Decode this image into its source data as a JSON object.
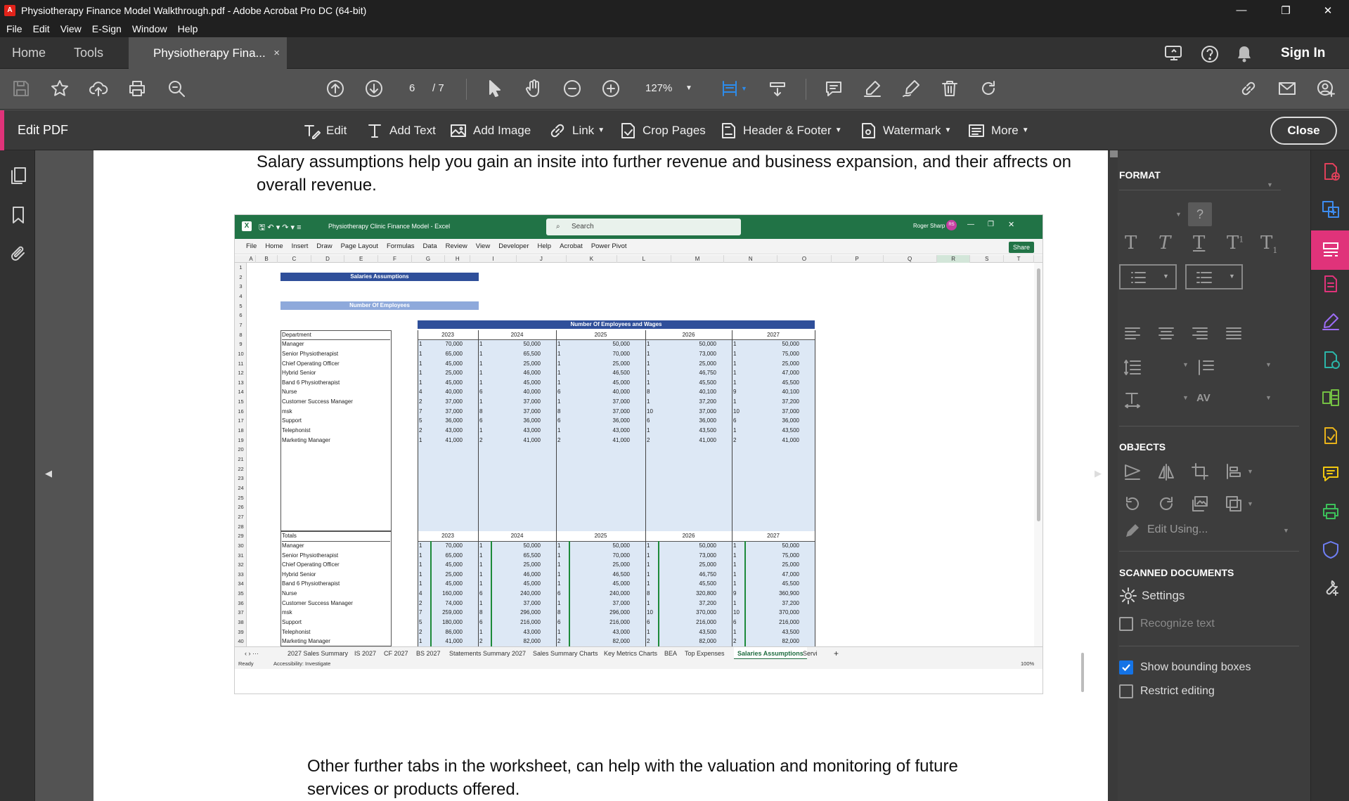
{
  "window": {
    "title": "Physiotherapy Finance Model Walkthrough.pdf - Adobe Acrobat Pro DC (64-bit)"
  },
  "menu": [
    "File",
    "Edit",
    "View",
    "E-Sign",
    "Window",
    "Help"
  ],
  "tabs": {
    "home": "Home",
    "tools": "Tools",
    "doc": "Physiotherapy Fina...",
    "close": "×"
  },
  "header_right": {
    "signin": "Sign In"
  },
  "toolbar": {
    "page_current": "6",
    "page_total": "/ 7",
    "zoom": "127%"
  },
  "editbar": {
    "label": "Edit PDF",
    "items": [
      "Edit",
      "Add Text",
      "Add Image",
      "Link",
      "Crop Pages",
      "Header & Footer",
      "Watermark",
      "More"
    ],
    "close": "Close"
  },
  "document": {
    "para1": "Salary assumptions help you gain an insite into further revenue and business expansion, and their affrects on overall revenue.",
    "para2": "Other further tabs in the worksheet, can help with the valuation and monitoring of future services or products offered."
  },
  "excel": {
    "title": "Physiotherapy Clinic Finance Model  -  Excel",
    "search": "Search",
    "user": "Roger Sharp",
    "user_initials": "RS",
    "share": "Share",
    "menu": [
      "File",
      "Home",
      "Insert",
      "Draw",
      "Page Layout",
      "Formulas",
      "Data",
      "Review",
      "View",
      "Developer",
      "Help",
      "Acrobat",
      "Power Pivot"
    ],
    "columns": [
      "A",
      "B",
      "C",
      "D",
      "E",
      "F",
      "G",
      "H",
      "I",
      "J",
      "K",
      "L",
      "M",
      "N",
      "O",
      "P",
      "Q",
      "R",
      "S",
      "T"
    ],
    "title1": "Salaries Assumptions",
    "title2": "Number Of Employees",
    "table_title": "Number Of Employees and Wages",
    "dept_header": "Department",
    "totals_header": "Totals",
    "years": [
      "2023",
      "2024",
      "2025",
      "2026",
      "2027"
    ],
    "departments": [
      "Manager",
      "Senior Physiotherapist",
      "Chief Operating Officer",
      "Hybrid Senior",
      "Band 6 Physiotherapist",
      "Nurse",
      "Customer Success Manager",
      "msk",
      "Support",
      "Telephonist",
      "Marketing Manager"
    ],
    "rows": [
      [
        [
          1,
          "70,000"
        ],
        [
          1,
          "50,000"
        ],
        [
          1,
          "50,000"
        ],
        [
          1,
          "50,000"
        ],
        [
          1,
          "50,000"
        ]
      ],
      [
        [
          1,
          "65,000"
        ],
        [
          1,
          "65,500"
        ],
        [
          1,
          "70,000"
        ],
        [
          1,
          "73,000"
        ],
        [
          1,
          "75,000"
        ]
      ],
      [
        [
          1,
          "45,000"
        ],
        [
          1,
          "25,000"
        ],
        [
          1,
          "25,000"
        ],
        [
          1,
          "25,000"
        ],
        [
          1,
          "25,000"
        ]
      ],
      [
        [
          1,
          "25,000"
        ],
        [
          1,
          "46,000"
        ],
        [
          1,
          "46,500"
        ],
        [
          1,
          "46,750"
        ],
        [
          1,
          "47,000"
        ]
      ],
      [
        [
          1,
          "45,000"
        ],
        [
          1,
          "45,000"
        ],
        [
          1,
          "45,000"
        ],
        [
          1,
          "45,500"
        ],
        [
          1,
          "45,500"
        ]
      ],
      [
        [
          4,
          "40,000"
        ],
        [
          6,
          "40,000"
        ],
        [
          6,
          "40,000"
        ],
        [
          8,
          "40,100"
        ],
        [
          9,
          "40,100"
        ]
      ],
      [
        [
          2,
          "37,000"
        ],
        [
          1,
          "37,000"
        ],
        [
          1,
          "37,000"
        ],
        [
          1,
          "37,200"
        ],
        [
          1,
          "37,200"
        ]
      ],
      [
        [
          7,
          "37,000"
        ],
        [
          8,
          "37,000"
        ],
        [
          8,
          "37,000"
        ],
        [
          10,
          "37,000"
        ],
        [
          10,
          "37,000"
        ]
      ],
      [
        [
          5,
          "36,000"
        ],
        [
          6,
          "36,000"
        ],
        [
          6,
          "36,000"
        ],
        [
          6,
          "36,000"
        ],
        [
          6,
          "36,000"
        ]
      ],
      [
        [
          2,
          "43,000"
        ],
        [
          1,
          "43,000"
        ],
        [
          1,
          "43,000"
        ],
        [
          1,
          "43,500"
        ],
        [
          1,
          "43,500"
        ]
      ],
      [
        [
          1,
          "41,000"
        ],
        [
          2,
          "41,000"
        ],
        [
          2,
          "41,000"
        ],
        [
          2,
          "41,000"
        ],
        [
          2,
          "41,000"
        ]
      ]
    ],
    "totals": [
      [
        [
          1,
          "70,000"
        ],
        [
          1,
          "50,000"
        ],
        [
          1,
          "50,000"
        ],
        [
          1,
          "50,000"
        ],
        [
          1,
          "50,000"
        ]
      ],
      [
        [
          1,
          "65,000"
        ],
        [
          1,
          "65,500"
        ],
        [
          1,
          "70,000"
        ],
        [
          1,
          "73,000"
        ],
        [
          1,
          "75,000"
        ]
      ],
      [
        [
          1,
          "45,000"
        ],
        [
          1,
          "25,000"
        ],
        [
          1,
          "25,000"
        ],
        [
          1,
          "25,000"
        ],
        [
          1,
          "25,000"
        ]
      ],
      [
        [
          1,
          "25,000"
        ],
        [
          1,
          "46,000"
        ],
        [
          1,
          "46,500"
        ],
        [
          1,
          "46,750"
        ],
        [
          1,
          "47,000"
        ]
      ],
      [
        [
          1,
          "45,000"
        ],
        [
          1,
          "45,000"
        ],
        [
          1,
          "45,000"
        ],
        [
          1,
          "45,500"
        ],
        [
          1,
          "45,500"
        ]
      ],
      [
        [
          4,
          "160,000"
        ],
        [
          6,
          "240,000"
        ],
        [
          6,
          "240,000"
        ],
        [
          8,
          "320,800"
        ],
        [
          9,
          "360,900"
        ]
      ],
      [
        [
          2,
          "74,000"
        ],
        [
          1,
          "37,000"
        ],
        [
          1,
          "37,000"
        ],
        [
          1,
          "37,200"
        ],
        [
          1,
          "37,200"
        ]
      ],
      [
        [
          7,
          "259,000"
        ],
        [
          8,
          "296,000"
        ],
        [
          8,
          "296,000"
        ],
        [
          10,
          "370,000"
        ],
        [
          10,
          "370,000"
        ]
      ],
      [
        [
          5,
          "180,000"
        ],
        [
          6,
          "216,000"
        ],
        [
          6,
          "216,000"
        ],
        [
          6,
          "216,000"
        ],
        [
          6,
          "216,000"
        ]
      ],
      [
        [
          2,
          "86,000"
        ],
        [
          1,
          "43,000"
        ],
        [
          1,
          "43,000"
        ],
        [
          1,
          "43,500"
        ],
        [
          1,
          "43,500"
        ]
      ],
      [
        [
          1,
          "41,000"
        ],
        [
          2,
          "82,000"
        ],
        [
          2,
          "82,000"
        ],
        [
          2,
          "82,000"
        ],
        [
          2,
          "82,000"
        ]
      ]
    ],
    "sheet_tabs": [
      "2027 Sales Summary",
      "IS 2027",
      "CF 2027",
      "BS 2027",
      "Statements Summary 2027",
      "Sales Summary Charts",
      "Key Metrics Charts",
      "BEA",
      "Top Expenses",
      "Salaries Assumptions",
      "Servi"
    ],
    "active_sheet": "Salaries Assumptions",
    "status_ready": "Ready",
    "status_access": "Accessibility: Investigate",
    "zoom": "100%"
  },
  "right_panel": {
    "format": "FORMAT",
    "objects": "OBJECTS",
    "edit_using": "Edit Using...",
    "scanned": "SCANNED DOCUMENTS",
    "settings": "Settings",
    "recognize": "Recognize text",
    "show_boxes": "Show bounding boxes",
    "restrict": "Restrict editing",
    "show_boxes_checked": true,
    "restrict_checked": false
  },
  "colors": {
    "accent": "#e0337a",
    "excel_green": "#217346",
    "excel_header": "#2f4f9a",
    "checkbox": "#1473e6"
  }
}
